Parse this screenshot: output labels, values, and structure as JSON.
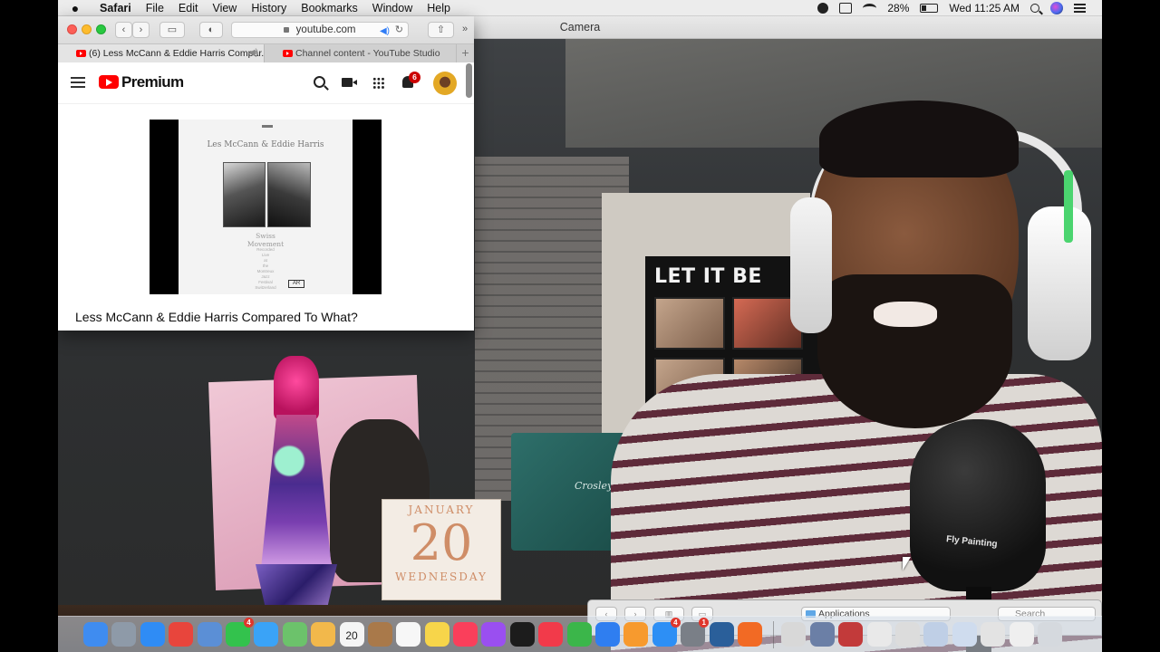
{
  "menubar": {
    "app_name": "Safari",
    "menus": [
      "File",
      "Edit",
      "View",
      "History",
      "Bookmarks",
      "Window",
      "Help"
    ],
    "battery_percent": "28%",
    "battery_level": 0.28,
    "clock": "Wed 11:25 AM"
  },
  "camera": {
    "window_title": "Camera",
    "poster_text": "LET IT BE",
    "calendar": {
      "month": "JANUARY",
      "day": "20",
      "weekday": "WEDNESDAY"
    },
    "turntable_brand": "Crosley",
    "mic_label": "Fly Painting"
  },
  "safari": {
    "address": "youtube.com",
    "tabs": [
      {
        "label": "(6) Less McCann & Eddie Harris Compar...",
        "active": true
      },
      {
        "label": "Channel content - YouTube Studio",
        "active": false
      }
    ],
    "new_tab_glyph": "+"
  },
  "youtube": {
    "brand": "Premium",
    "notification_count": "6",
    "album": {
      "title": "Les McCann & Eddie Harris",
      "subtitle": "Swiss\nMovement",
      "notes": "Recorded\nLive\nat\nthe\nMontreux\nJazz\nFestival\nSwitzerland",
      "label_logo": "AR"
    },
    "video_title": "Less McCann & Eddie Harris Compared To What?"
  },
  "finder": {
    "location": "Applications",
    "search_placeholder": "Search"
  },
  "dock": {
    "apps": [
      {
        "name": "finder-icon",
        "color": "#3f8cf0"
      },
      {
        "name": "launchpad-icon",
        "color": "#8e9aa8"
      },
      {
        "name": "safari-icon",
        "color": "#2f8cf5"
      },
      {
        "name": "chrome-icon",
        "color": "#e8453c"
      },
      {
        "name": "preview-icon",
        "color": "#5b8fd6"
      },
      {
        "name": "facetime-icon",
        "color": "#33c24d",
        "badge": "4"
      },
      {
        "name": "messages-icon",
        "color": "#3aa3f7"
      },
      {
        "name": "maps-icon",
        "color": "#6cc26b"
      },
      {
        "name": "photos-icon",
        "color": "#f2b84b"
      },
      {
        "name": "calendar-icon",
        "color": "#f5f5f5",
        "label": "20"
      },
      {
        "name": "notes-brown-icon",
        "color": "#a9794a"
      },
      {
        "name": "reminders-icon",
        "color": "#f7f7f7"
      },
      {
        "name": "notes-icon",
        "color": "#f7d54a"
      },
      {
        "name": "music-icon",
        "color": "#fa3f5b"
      },
      {
        "name": "podcasts-icon",
        "color": "#9a4ff0"
      },
      {
        "name": "tv-icon",
        "color": "#1c1c1c"
      },
      {
        "name": "news-icon",
        "color": "#f23a4a"
      },
      {
        "name": "numbers-icon",
        "color": "#3bb64a"
      },
      {
        "name": "keynote-icon",
        "color": "#2f7ef0"
      },
      {
        "name": "pages-icon",
        "color": "#f79a2e"
      },
      {
        "name": "app-store-icon",
        "color": "#2d8ff5",
        "badge": "4"
      },
      {
        "name": "system-preferences-icon",
        "color": "#7a7f87",
        "badge": "1"
      },
      {
        "name": "quicktime-icon",
        "color": "#2a5f9a"
      },
      {
        "name": "recorder-icon",
        "color": "#f26a24"
      }
    ],
    "utilities": [
      {
        "name": "script-editor-icon",
        "color": "#d8d8d8"
      },
      {
        "name": "scanner-icon",
        "color": "#6b7fa6"
      },
      {
        "name": "media-app-icon",
        "color": "#c23a3a"
      },
      {
        "name": "documents-stack-icon",
        "color": "#e9e9e9"
      },
      {
        "name": "downloads-stack-icon",
        "color": "#dcdcdc"
      },
      {
        "name": "screenshot-stack-icon",
        "color": "#bfcfe6"
      },
      {
        "name": "folder-stack-icon",
        "color": "#cfdcee"
      },
      {
        "name": "desktop-stack-icon",
        "color": "#e3e3e3"
      },
      {
        "name": "files-stack-icon",
        "color": "#efefef"
      },
      {
        "name": "trash-icon",
        "color": "#d5d9de"
      }
    ]
  }
}
